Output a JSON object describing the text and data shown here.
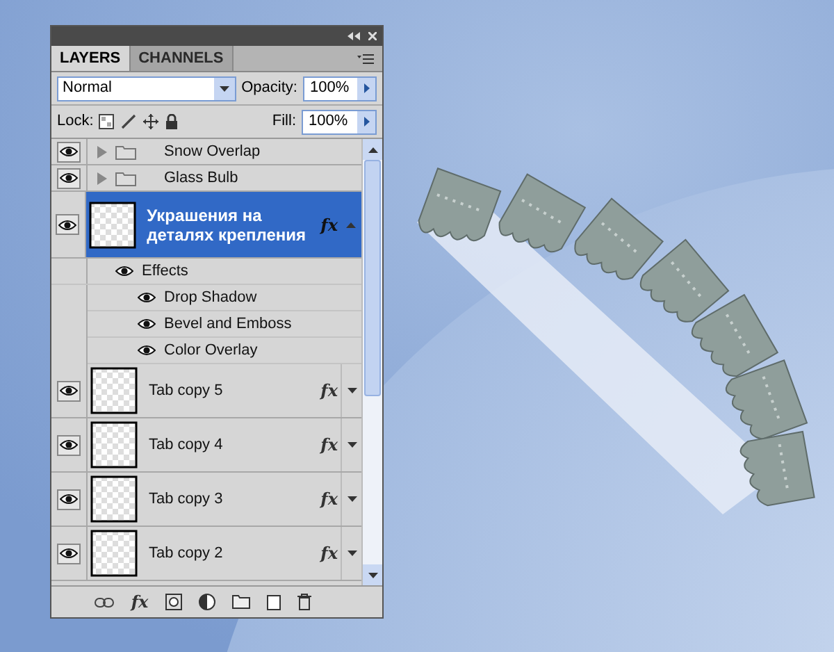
{
  "panel": {
    "tabs": [
      {
        "label": "LAYERS",
        "selected": true
      },
      {
        "label": "CHANNELS",
        "selected": false
      }
    ],
    "style_button": "fx",
    "blend_mode": "Normal",
    "opacity_label": "Opacity:",
    "opacity": "100%",
    "lock_label": "Lock:",
    "fill_label": "Fill:",
    "fill": "100%",
    "layers": [
      {
        "kind": "group",
        "name": "Snow Overlap",
        "visible": true,
        "expanded": false
      },
      {
        "kind": "group",
        "name": "Glass Bulb",
        "visible": true,
        "expanded": false
      },
      {
        "kind": "layer",
        "name": "Украшения на деталях крепления",
        "visible": true,
        "selected": true,
        "fx": "fx",
        "expanded": true,
        "effects_label": "Effects",
        "effects": [
          {
            "name": "Drop Shadow",
            "visible": true
          },
          {
            "name": "Bevel and Emboss",
            "visible": true
          },
          {
            "name": "Color Overlay",
            "visible": true
          }
        ]
      },
      {
        "kind": "layer",
        "name": "Tab copy 5",
        "visible": true,
        "selected": false,
        "fx": "fx",
        "expanded": false
      },
      {
        "kind": "layer",
        "name": "Tab copy 4",
        "visible": true,
        "selected": false,
        "fx": "fx",
        "expanded": false
      },
      {
        "kind": "layer",
        "name": "Tab copy 3",
        "visible": true,
        "selected": false,
        "fx": "fx",
        "expanded": false
      },
      {
        "kind": "layer",
        "name": "Tab copy 2",
        "visible": true,
        "selected": false,
        "fx": "fx",
        "expanded": false
      }
    ]
  }
}
